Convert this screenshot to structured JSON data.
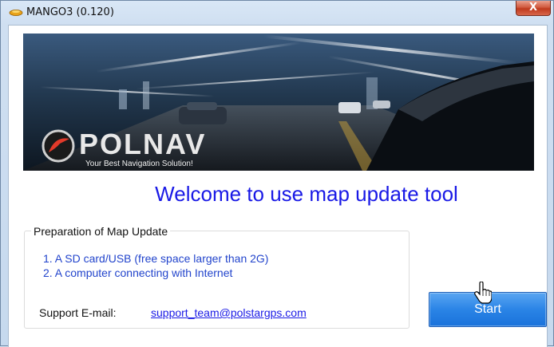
{
  "window": {
    "title": "MANGO3 (0.120)",
    "close_glyph": "X"
  },
  "banner": {
    "brand": "POLNAV",
    "tagline": "Your Best Navigation Solution!"
  },
  "main": {
    "welcome": "Welcome to use map update tool"
  },
  "preparation": {
    "title": "Preparation of Map Update",
    "items": [
      "1. A SD card/USB (free space larger than 2G)",
      "2. A computer connecting with Internet"
    ]
  },
  "support": {
    "label": "Support E-mail:",
    "email": "support_team@polstargps.com"
  },
  "actions": {
    "start_label": "Start"
  },
  "colors": {
    "welcome_text": "#1919e6",
    "item_text": "#2244cc",
    "link": "#1a1ae6",
    "start_button": "#2a84e6",
    "close_button": "#c8462a"
  }
}
